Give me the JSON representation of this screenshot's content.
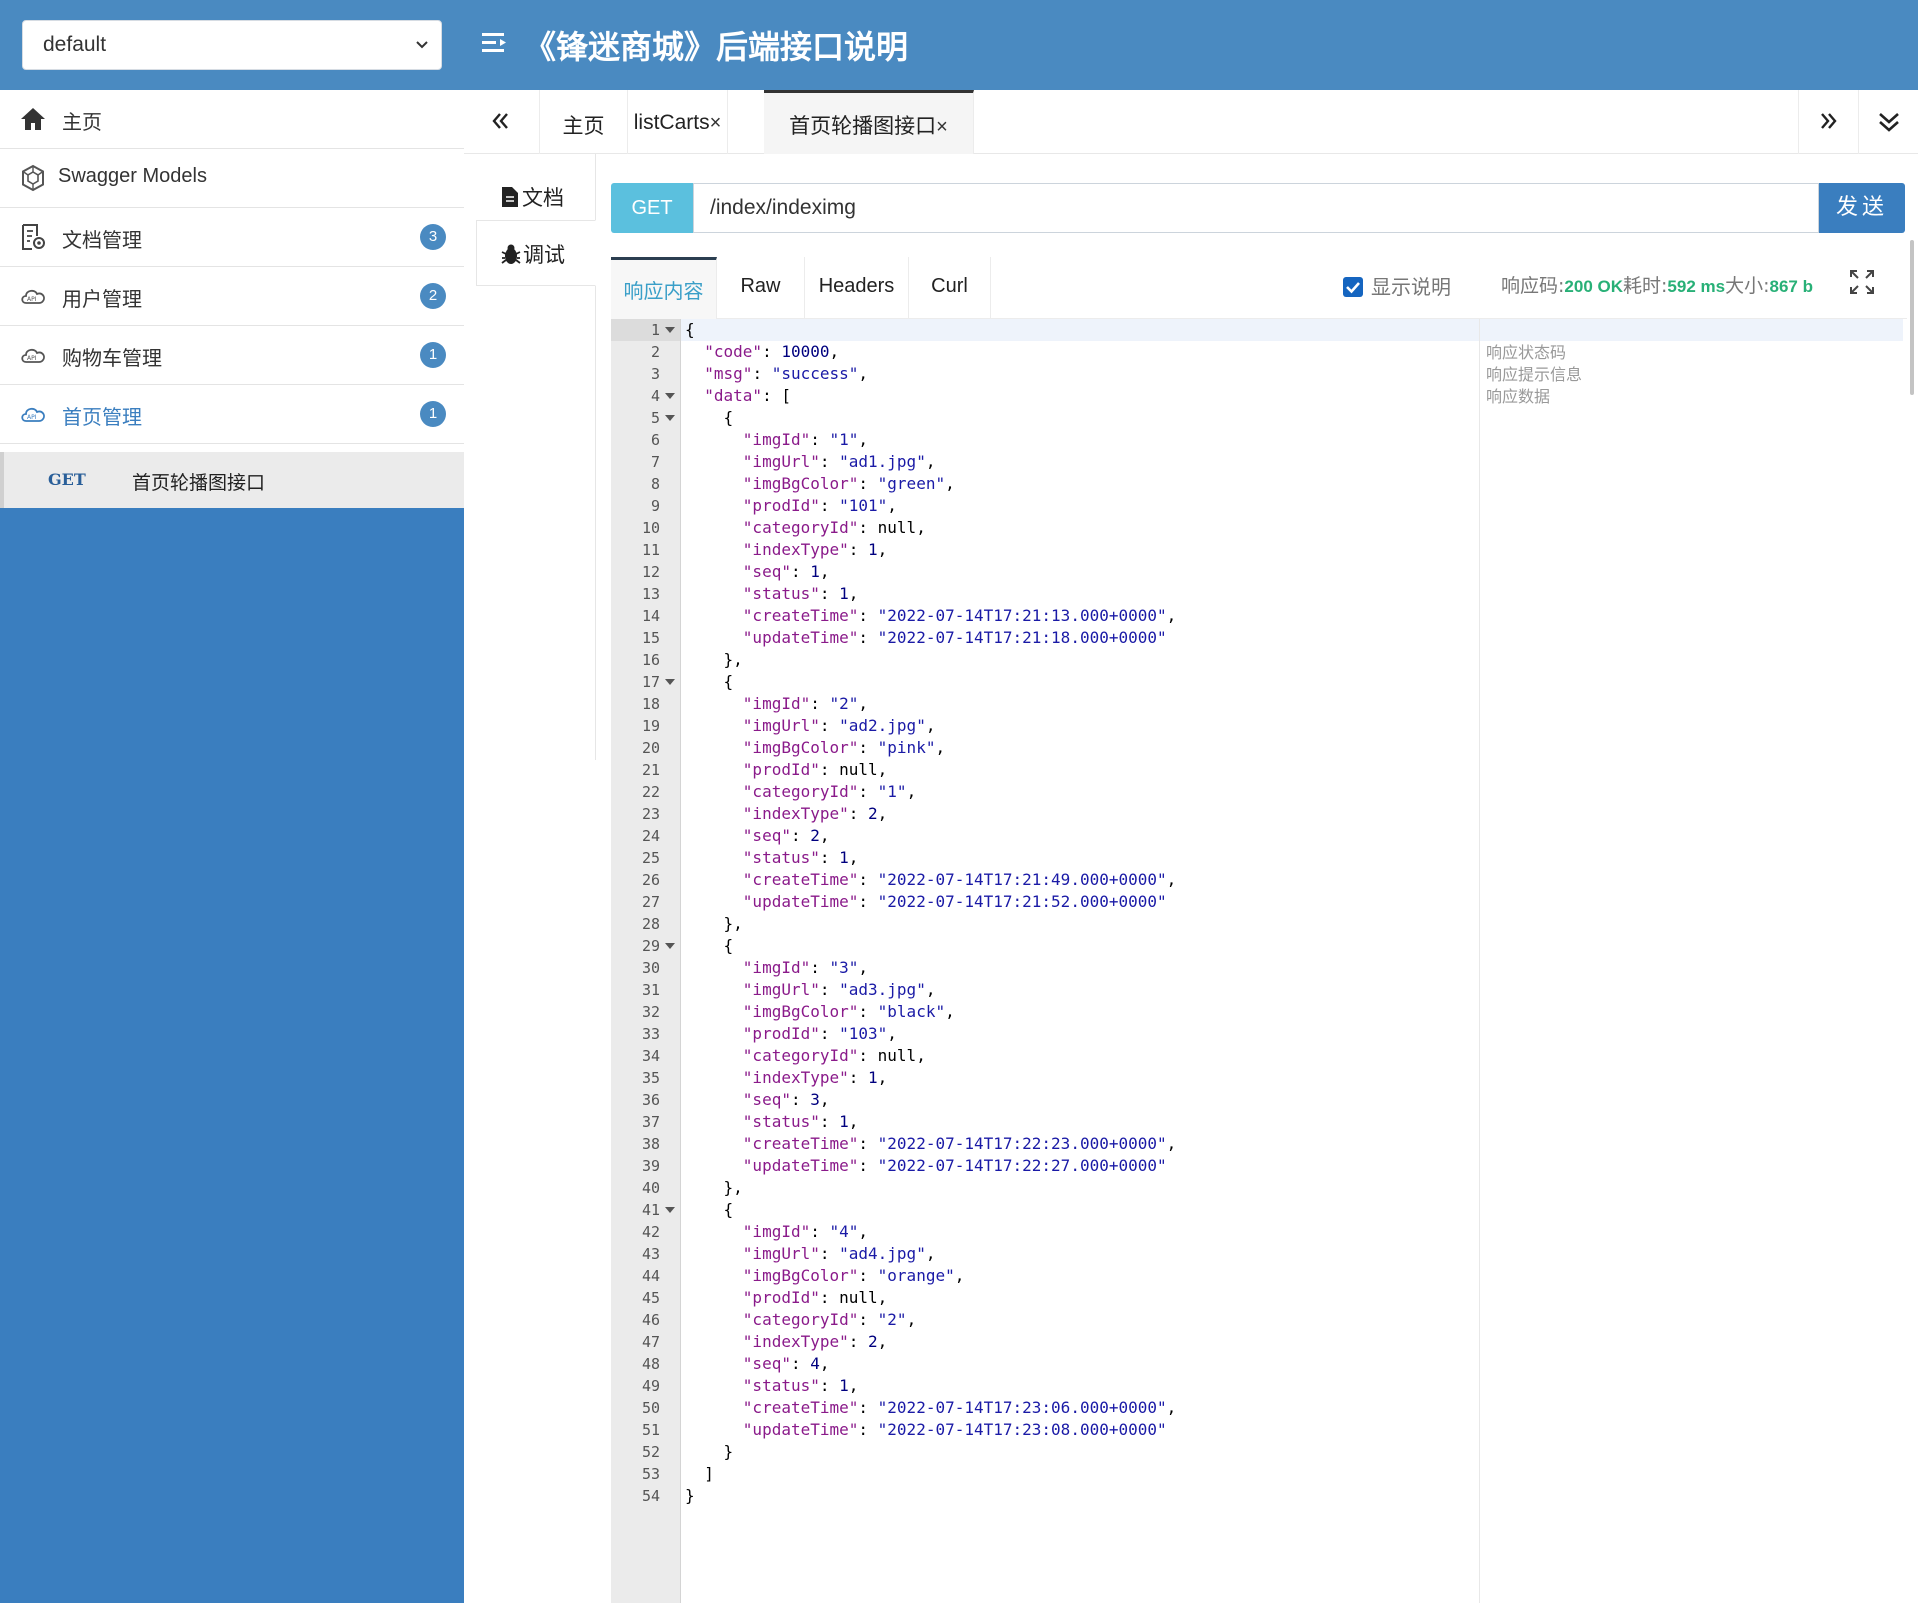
{
  "header": {
    "group_select": "default",
    "title": "《锋迷商城》后端接口说明"
  },
  "sidebar": {
    "items": [
      {
        "label": "主页",
        "icon": "home-icon"
      },
      {
        "label": "Swagger Models",
        "icon": "models-icon"
      },
      {
        "label": "文档管理",
        "icon": "doc-settings-icon",
        "badge": "3"
      },
      {
        "label": "用户管理",
        "icon": "api-cloud-icon",
        "badge": "2"
      },
      {
        "label": "购物车管理",
        "icon": "api-cloud-icon",
        "badge": "1"
      },
      {
        "label": "首页管理",
        "icon": "api-cloud-icon",
        "badge": "1"
      }
    ],
    "api_entry": {
      "method": "GET",
      "name": "首页轮播图接口"
    }
  },
  "tabs": [
    {
      "label": "主页",
      "closable": false
    },
    {
      "label": "listCarts",
      "closable": true
    },
    {
      "label": "首页轮播图接口",
      "closable": true,
      "active": true
    }
  ],
  "tab_close_glyph": "×",
  "vtabs": {
    "doc": "文档",
    "debug": "调试"
  },
  "request": {
    "method": "GET",
    "url": "/index/indeximg",
    "send": "发送"
  },
  "response_tabs": [
    "响应内容",
    "Raw",
    "Headers",
    "Curl"
  ],
  "response_meta": {
    "show_desc_label": "显示说明",
    "show_desc_checked": true,
    "code_label": "响应码:",
    "code_value": "200 OK",
    "time_label": "耗时:",
    "time_value": "592 ms",
    "size_label": "大小:",
    "size_value": "867 b"
  },
  "descriptions": [
    "响应状态码",
    "响应提示信息",
    "响应数据"
  ],
  "response_body": {
    "code": 10000,
    "msg": "success",
    "data": [
      {
        "imgId": "1",
        "imgUrl": "ad1.jpg",
        "imgBgColor": "green",
        "prodId": "101",
        "categoryId": null,
        "indexType": 1,
        "seq": 1,
        "status": 1,
        "createTime": "2022-07-14T17:21:13.000+0000",
        "updateTime": "2022-07-14T17:21:18.000+0000"
      },
      {
        "imgId": "2",
        "imgUrl": "ad2.jpg",
        "imgBgColor": "pink",
        "prodId": null,
        "categoryId": "1",
        "indexType": 2,
        "seq": 2,
        "status": 1,
        "createTime": "2022-07-14T17:21:49.000+0000",
        "updateTime": "2022-07-14T17:21:52.000+0000"
      },
      {
        "imgId": "3",
        "imgUrl": "ad3.jpg",
        "imgBgColor": "black",
        "prodId": "103",
        "categoryId": null,
        "indexType": 1,
        "seq": 3,
        "status": 1,
        "createTime": "2022-07-14T17:22:23.000+0000",
        "updateTime": "2022-07-14T17:22:27.000+0000"
      },
      {
        "imgId": "4",
        "imgUrl": "ad4.jpg",
        "imgBgColor": "orange",
        "prodId": null,
        "categoryId": "2",
        "indexType": 2,
        "seq": 4,
        "status": 1,
        "createTime": "2022-07-14T17:23:06.000+0000",
        "updateTime": "2022-07-14T17:23:08.000+0000"
      }
    ]
  },
  "colors": {
    "header_bg": "#4a8ac1",
    "sidebar_bg": "#3a7ebf",
    "get_badge": "#5bc0de",
    "send_button": "#3a7ebf",
    "status_ok": "#28b077"
  }
}
